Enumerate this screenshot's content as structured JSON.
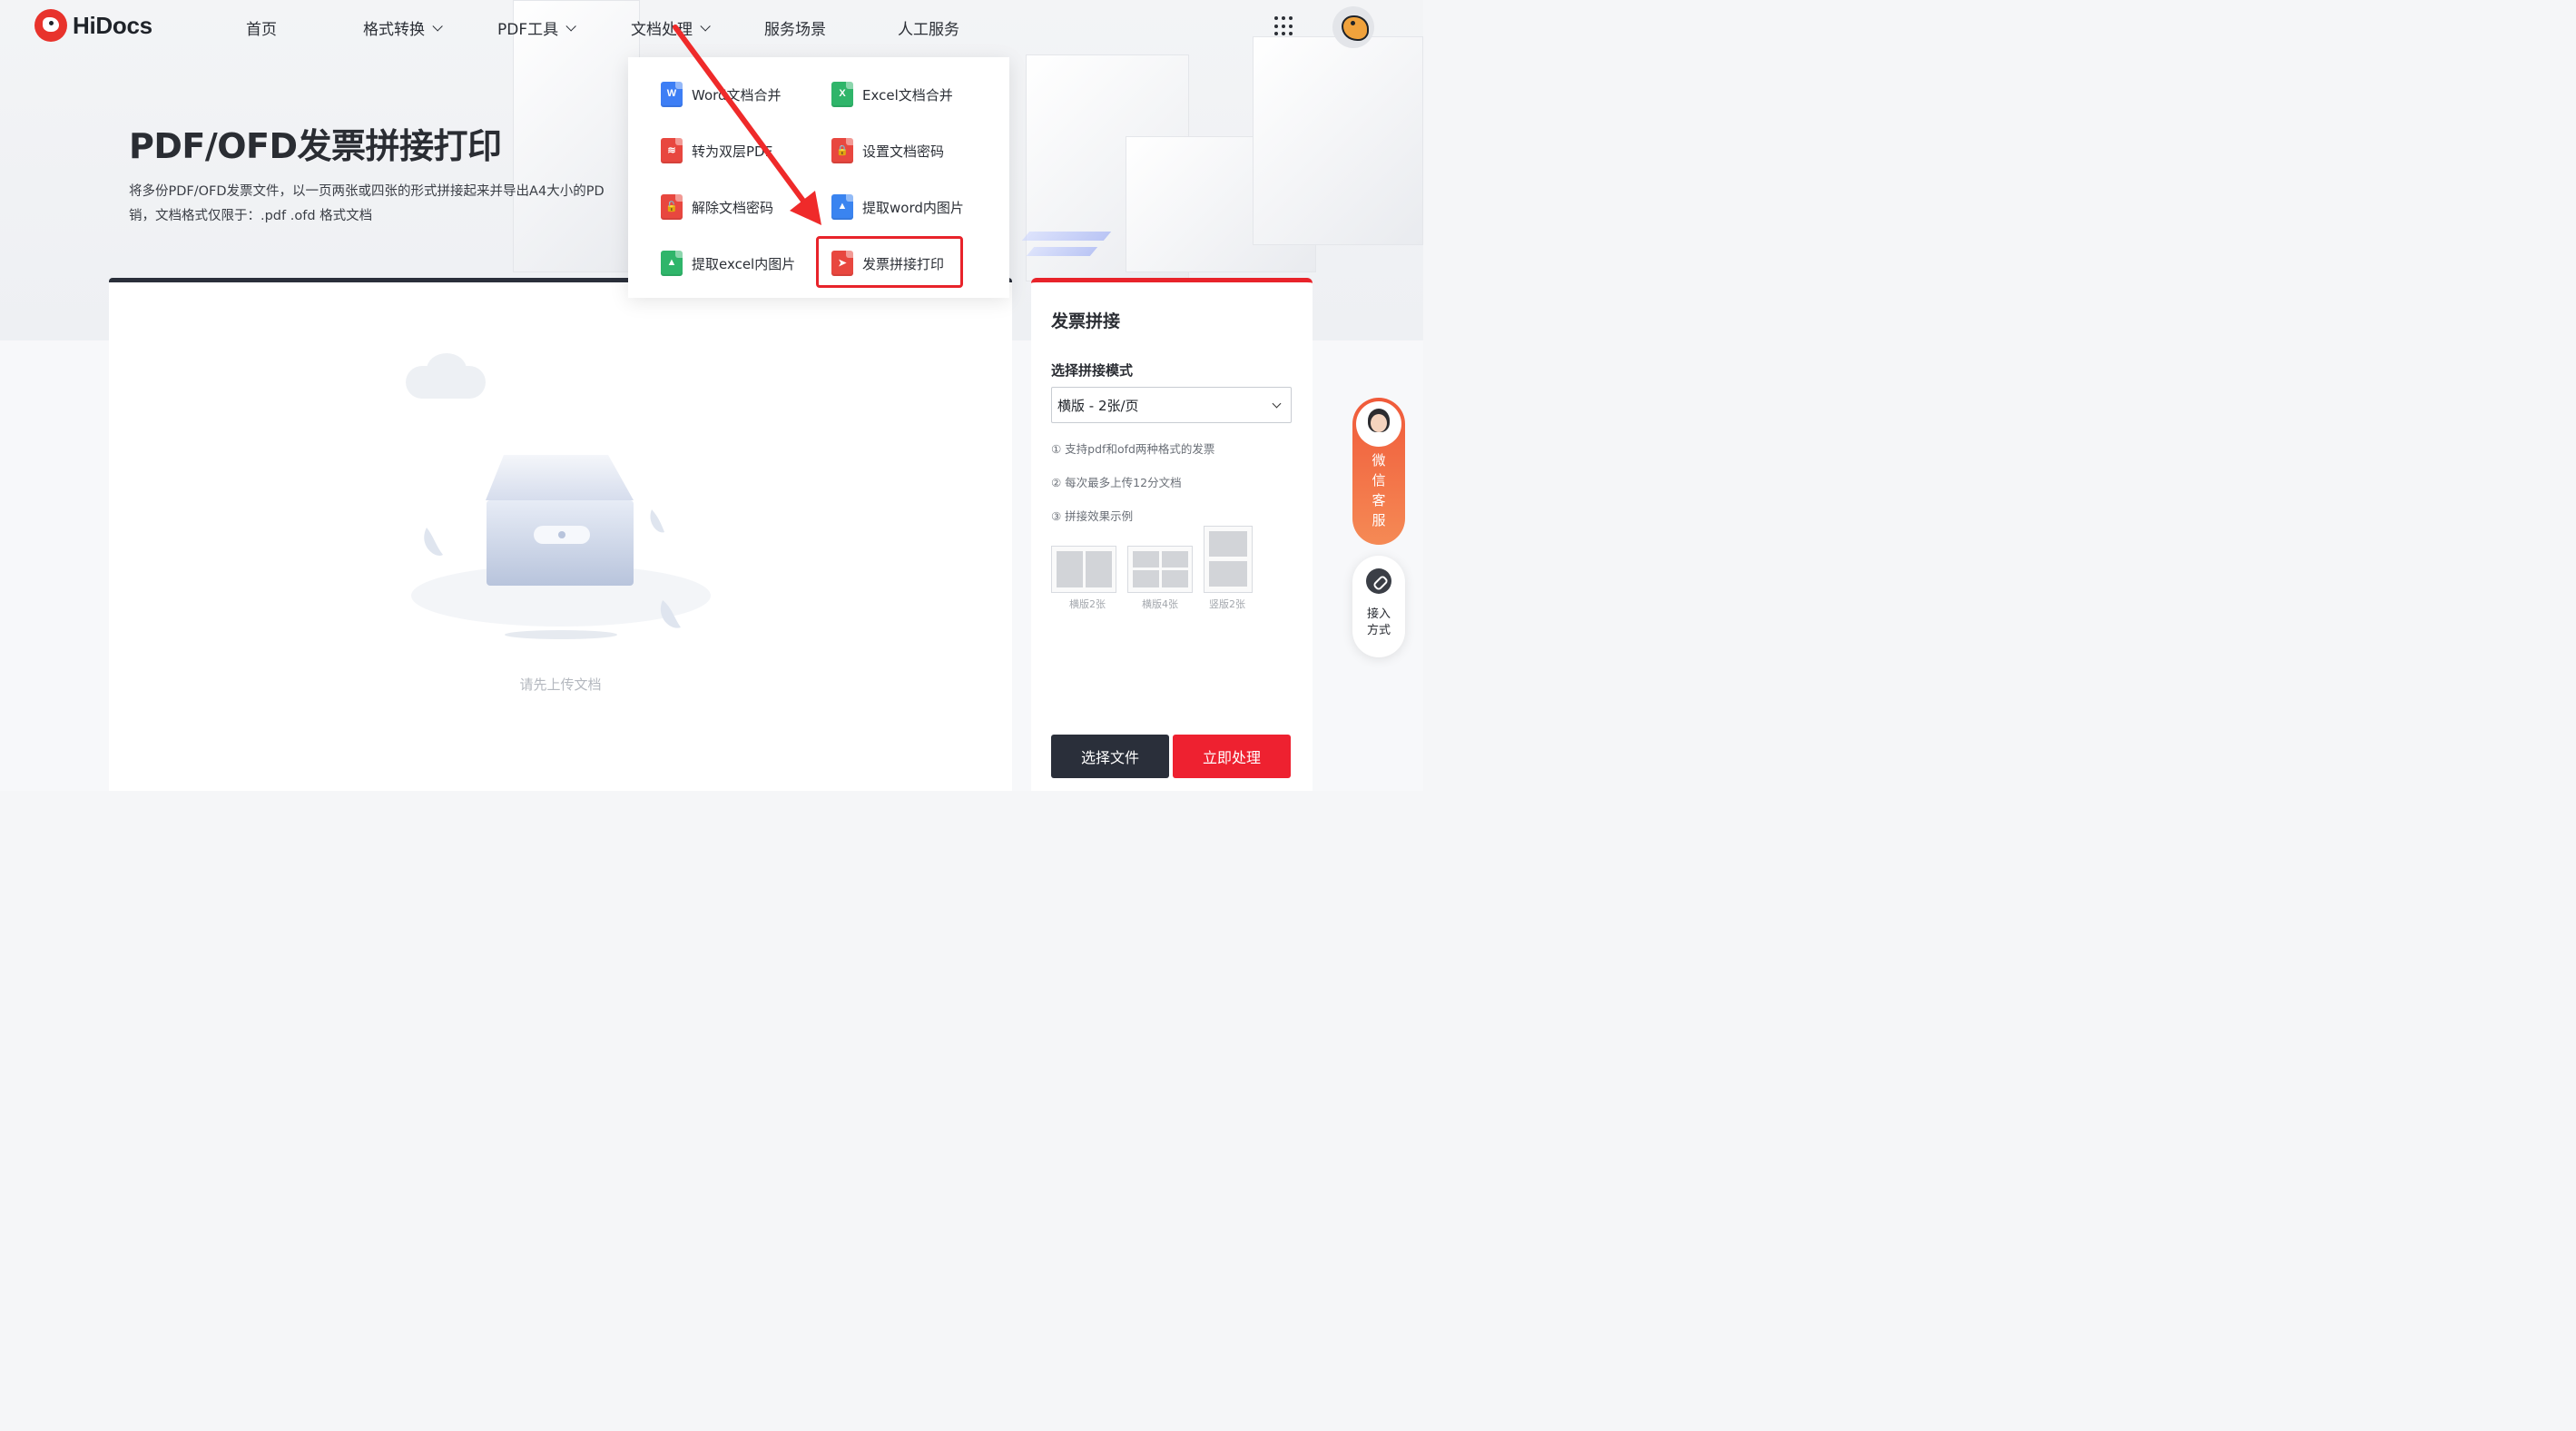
{
  "nav": {
    "logo_text": "HiDocs",
    "items": [
      {
        "label": "首页",
        "has_caret": false
      },
      {
        "label": "格式转换",
        "has_caret": true
      },
      {
        "label": "PDF工具",
        "has_caret": true
      },
      {
        "label": "文档处理",
        "has_caret": true
      },
      {
        "label": "服务场景",
        "has_caret": false
      },
      {
        "label": "人工服务",
        "has_caret": false
      }
    ]
  },
  "hero": {
    "title": "PDF/OFD发票拼接打印",
    "desc_line1": "将多份PDF/OFD发票文件，以一页两张或四张的形式拼接起来并导出A4大小的PD",
    "desc_line2": "销，文档格式仅限于：.pdf .ofd 格式文档"
  },
  "dropdown": {
    "items": [
      {
        "label": "Word文档合并",
        "icon": "word-doc-icon"
      },
      {
        "label": "Excel文档合并",
        "icon": "excel-doc-icon"
      },
      {
        "label": "转为双层PDF",
        "icon": "layers-pdf-icon"
      },
      {
        "label": "设置文档密码",
        "icon": "lock-doc-icon"
      },
      {
        "label": "解除文档密码",
        "icon": "unlock-doc-icon"
      },
      {
        "label": "提取word内图片",
        "icon": "word-image-icon"
      },
      {
        "label": "提取excel内图片",
        "icon": "excel-image-icon"
      },
      {
        "label": "发票拼接打印",
        "icon": "invoice-print-icon"
      }
    ]
  },
  "upload": {
    "hint": "请先上传文档"
  },
  "panel": {
    "title": "发票拼接",
    "mode_label": "选择拼接模式",
    "selected_mode": "横版 - 2张/页",
    "tips": [
      "① 支持pdf和ofd两种格式的发票",
      "② 每次最多上传12分文档",
      "③ 拼接效果示例"
    ],
    "layouts": [
      "横版2张",
      "横版4张",
      "竖版2张"
    ],
    "btn_select": "选择文件",
    "btn_process": "立即处理"
  },
  "float": {
    "wechat_chars": [
      "微",
      "信",
      "客",
      "服"
    ],
    "access_line1": "接入",
    "access_line2": "方式"
  },
  "colors": {
    "brand_red": "#e8232a",
    "dark": "#2a2f3a"
  }
}
